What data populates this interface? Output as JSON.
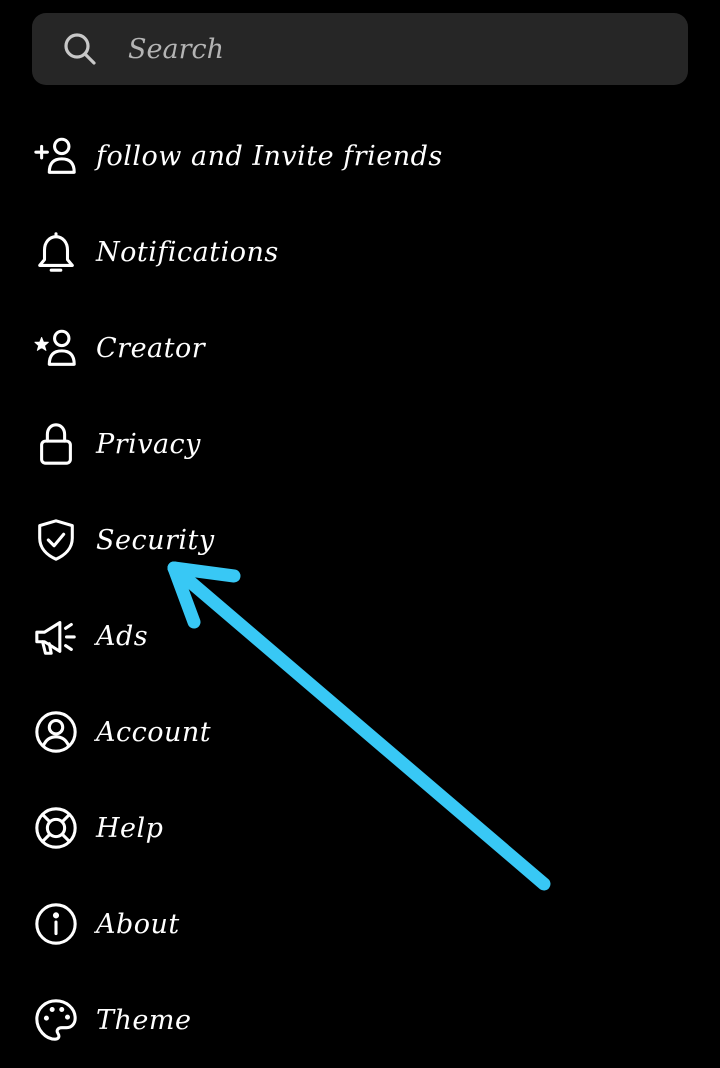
{
  "search": {
    "placeholder": "Search",
    "icon": "search-icon"
  },
  "menu": {
    "items": [
      {
        "label": "follow and Invite friends",
        "icon": "add-person-icon"
      },
      {
        "label": "Notifications",
        "icon": "bell-icon"
      },
      {
        "label": "Creator",
        "icon": "star-person-icon"
      },
      {
        "label": "Privacy",
        "icon": "lock-icon"
      },
      {
        "label": "Security",
        "icon": "shield-check-icon"
      },
      {
        "label": "Ads",
        "icon": "megaphone-icon"
      },
      {
        "label": "Account",
        "icon": "account-circle-icon"
      },
      {
        "label": "Help",
        "icon": "lifebuoy-icon"
      },
      {
        "label": "About",
        "icon": "info-icon"
      },
      {
        "label": "Theme",
        "icon": "palette-icon"
      }
    ]
  },
  "annotation": {
    "arrow_color": "#38c8f5",
    "points_to": "Security"
  },
  "colors": {
    "background": "#000000",
    "search_bg": "#262626",
    "text": "#ffffff",
    "placeholder": "#b4b4b4"
  }
}
